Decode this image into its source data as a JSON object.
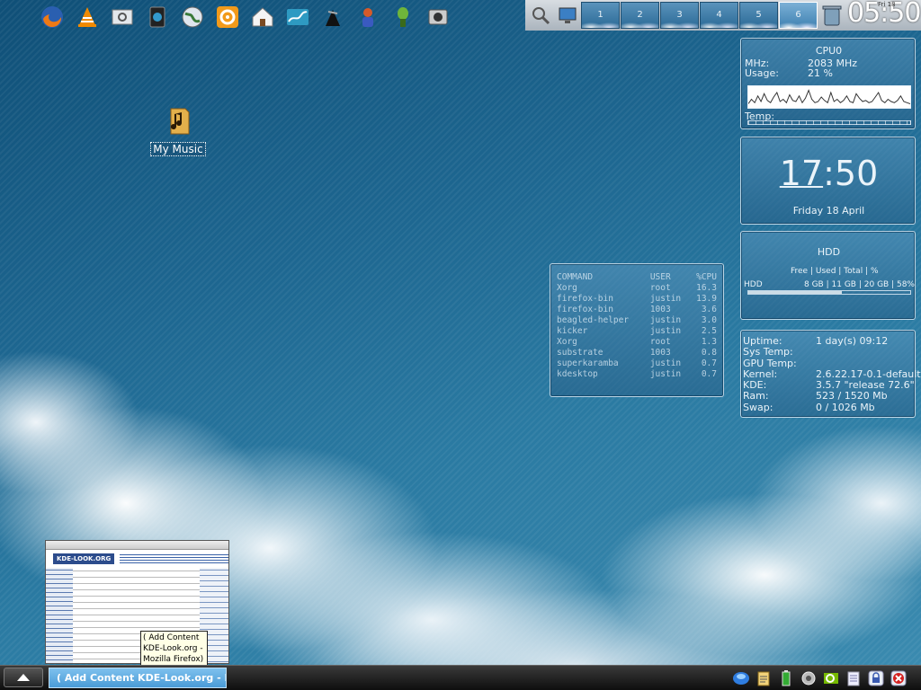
{
  "launcher": {
    "icons": [
      "firefox-icon",
      "vlc-icon",
      "kcontrol-icon",
      "terminal-icon",
      "network-globe-icon",
      "settings-gear-icon",
      "home-folder-icon",
      "chart-app-icon",
      "game-icon",
      "kids-game-icon",
      "alien-icon",
      "camera-icon"
    ]
  },
  "pager": {
    "desktops": [
      "1",
      "2",
      "3",
      "4",
      "5",
      "6"
    ],
    "active_desktop": "6",
    "clock_time": "05:50",
    "clock_date": "Fri 18"
  },
  "desktop_icons": [
    {
      "label": "My Music"
    }
  ],
  "cpu_widget": {
    "title": "CPU0",
    "mhz_label": "MHz:",
    "mhz_value": "2083 MHz",
    "usage_label": "Usage:",
    "usage_value": "21 %",
    "temp_label": "Temp:",
    "graph": [
      2,
      6,
      3,
      9,
      4,
      11,
      5,
      3,
      8,
      12,
      4,
      6,
      3,
      10,
      5,
      4,
      9,
      3,
      7,
      14,
      6,
      3,
      4,
      8,
      5,
      3,
      12,
      4,
      6,
      3,
      5,
      9,
      4,
      3,
      11,
      7,
      4,
      5,
      3,
      4,
      8,
      12,
      5,
      3,
      6,
      4,
      3,
      5,
      9,
      4,
      3,
      2
    ]
  },
  "clock_widget": {
    "hours": "17",
    "minutes": "50",
    "date": "Friday 18 April"
  },
  "hdd_widget": {
    "title": "HDD",
    "header": [
      "Free",
      "Used",
      "Total",
      "%"
    ],
    "row": {
      "name": "HDD",
      "free": "8 GB",
      "used": "11 GB",
      "total": "20 GB",
      "percent": "58%"
    },
    "fill": 0.58
  },
  "sys_widget": {
    "rows": [
      {
        "label": "Uptime:",
        "value": "1 day(s)   09:12"
      },
      {
        "label": "Sys Temp:",
        "value": ""
      },
      {
        "label": "GPU Temp:",
        "value": ""
      },
      {
        "label": "Kernel:",
        "value": "2.6.22.17-0.1-default"
      },
      {
        "label": "KDE:",
        "value": "3.5.7 \"release 72.6\""
      },
      {
        "label": "Ram:",
        "value": "523 / 1520 Mb"
      },
      {
        "label": "Swap:",
        "value": "0 / 1026 Mb"
      }
    ]
  },
  "process_widget": {
    "headers": [
      "COMMAND",
      "USER",
      "%CPU"
    ],
    "rows": [
      [
        "Xorg",
        "root",
        "16.3"
      ],
      [
        "firefox-bin",
        "justin",
        "13.9"
      ],
      [
        "firefox-bin",
        "1003",
        "3.6"
      ],
      [
        "beagled-helper",
        "justin",
        "3.0"
      ],
      [
        "kicker",
        "justin",
        "2.5"
      ],
      [
        "Xorg",
        "root",
        "1.3"
      ],
      [
        "substrate",
        "1003",
        "0.8"
      ],
      [
        "superkaramba",
        "justin",
        "0.7"
      ],
      [
        "kdesktop",
        "justin",
        "0.7"
      ]
    ]
  },
  "taskbar": {
    "task_label": "( Add Content KDE-Look.org - Mozil",
    "tooltip": "( Add Content KDE-Look.org - Mozilla Firefox)",
    "thumbnail_logo": "KDE-LOOK.ORG",
    "tray_icons": [
      "network-icon",
      "klipper-icon",
      "battery-icon",
      "weather-icon",
      "nvidia-icon",
      "notes-icon",
      "lock-icon",
      "logout-icon"
    ]
  },
  "colors": {
    "accent": "#4a9bd6",
    "panel_top": "#aab4bd",
    "taskbar": "#1a1a1a"
  }
}
